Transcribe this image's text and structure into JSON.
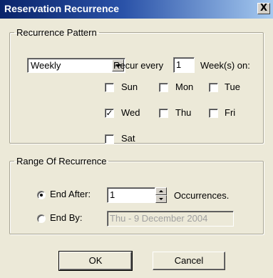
{
  "window": {
    "title": "Reservation Recurrence",
    "close_glyph": "X",
    "close_icon": "close-icon"
  },
  "recurrence_pattern": {
    "legend": "Recurrence Pattern",
    "frequency": {
      "selected": "Weekly"
    },
    "recur_every_label": "Recur every",
    "recur_every_value": "1",
    "weeks_on_label": "Week(s) on:",
    "days": [
      {
        "label": "Sun",
        "checked": false
      },
      {
        "label": "Mon",
        "checked": false
      },
      {
        "label": "Tue",
        "checked": false
      },
      {
        "label": "Wed",
        "checked": true
      },
      {
        "label": "Thu",
        "checked": false
      },
      {
        "label": "Fri",
        "checked": false
      },
      {
        "label": "Sat",
        "checked": false
      }
    ],
    "check_glyph": "✓"
  },
  "range_of_recurrence": {
    "legend": "Range Of Recurrence",
    "end_after": {
      "label": "End After:",
      "selected": true,
      "value": "1",
      "suffix": "Occurrences."
    },
    "end_by": {
      "label": "End By:",
      "selected": false,
      "value": "Thu - 9 December 2004"
    }
  },
  "buttons": {
    "ok": "OK",
    "cancel": "Cancel"
  }
}
